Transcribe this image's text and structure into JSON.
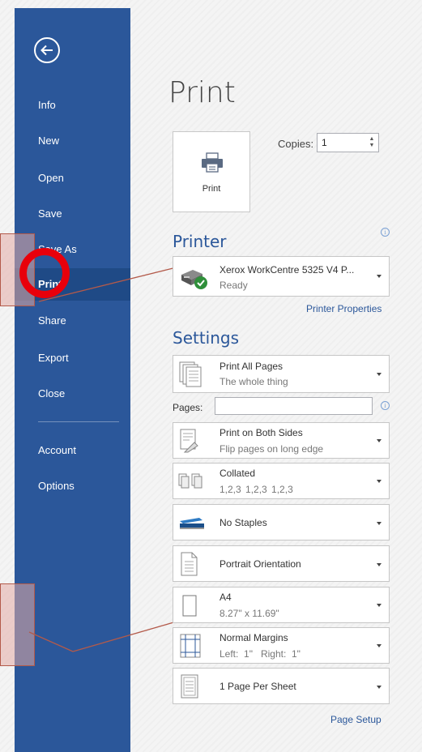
{
  "sidebar": {
    "back": "Back",
    "items": [
      {
        "label": "Info"
      },
      {
        "label": "New"
      },
      {
        "label": "Open"
      },
      {
        "label": "Save"
      },
      {
        "label": "Save As"
      },
      {
        "label": "Print"
      },
      {
        "label": "Share"
      },
      {
        "label": "Export"
      },
      {
        "label": "Close"
      },
      {
        "label": "Account"
      },
      {
        "label": "Options"
      }
    ]
  },
  "main": {
    "title": "Print",
    "print_button_label": "Print",
    "copies_label": "Copies:",
    "copies_value": "1",
    "printer_heading": "Printer",
    "printer": {
      "name": "Xerox WorkCentre 5325 V4 P...",
      "status": "Ready"
    },
    "printer_properties_link": "Printer Properties",
    "settings_heading": "Settings",
    "settings": [
      {
        "title": "Print All Pages",
        "subtitle": "The whole thing"
      },
      {
        "title": "Print on Both Sides",
        "subtitle": "Flip pages on long edge"
      },
      {
        "title": "Collated",
        "subtitle": "1,2,3   1,2,3   1,2,3"
      },
      {
        "title": "No Staples",
        "subtitle": ""
      },
      {
        "title": "Portrait Orientation",
        "subtitle": ""
      },
      {
        "title": "A4",
        "subtitle": "8.27\" x 11.69\""
      },
      {
        "title": "Normal Margins",
        "subtitle": "Left:  1\"   Right:  1\""
      },
      {
        "title": "1 Page Per Sheet",
        "subtitle": ""
      }
    ],
    "pages_label": "Pages:",
    "pages_value": "",
    "page_setup_link": "Page Setup"
  },
  "colors": {
    "sidebar": "#2b579a",
    "sidebar_active": "#1f4a86",
    "highlight_circle": "#e8000b",
    "callout_line": "#b35a4a"
  }
}
